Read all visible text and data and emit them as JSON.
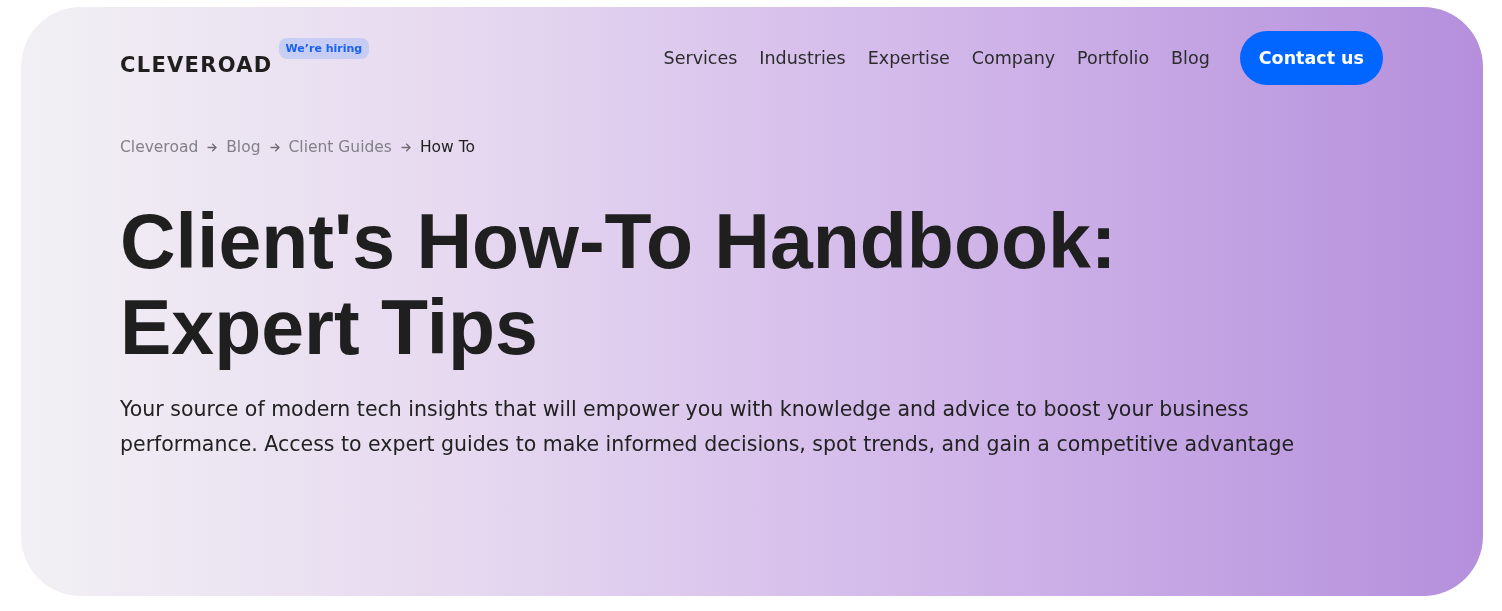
{
  "header": {
    "logo": "CLEVEROAD",
    "badge": "We’re hiring",
    "nav": [
      {
        "label": "Services"
      },
      {
        "label": "Industries"
      },
      {
        "label": "Expertise"
      },
      {
        "label": "Company"
      },
      {
        "label": "Portfolio"
      },
      {
        "label": "Blog"
      }
    ],
    "cta": "Contact us"
  },
  "breadcrumb": [
    {
      "label": "Cleveroad",
      "current": false
    },
    {
      "label": "Blog",
      "current": false
    },
    {
      "label": "Client Guides",
      "current": false
    },
    {
      "label": "How To",
      "current": true
    }
  ],
  "hero": {
    "title": "Client's How-To Handbook: Expert Tips",
    "description": "Your source of modern tech insights that will empower you with knowledge and advice to boost your business performance. Access to expert guides to make informed decisions, spot trends, and gain a competitive advantage"
  }
}
